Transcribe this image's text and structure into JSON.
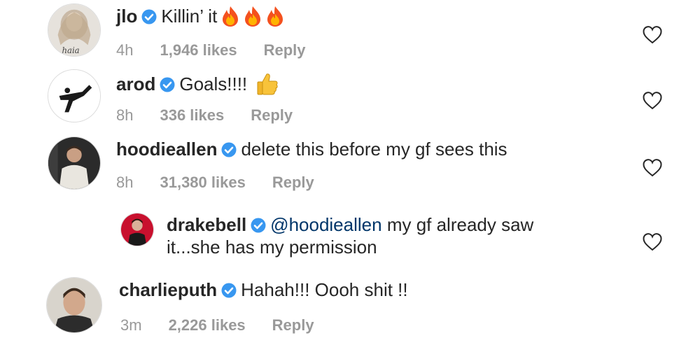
{
  "comments": [
    {
      "username": "jlo",
      "text": "Killin’ it",
      "emoji": [
        "fire-emoji",
        "fire-emoji",
        "fire-emoji"
      ],
      "time": "4h",
      "likes": "1,946 likes",
      "reply": "Reply"
    },
    {
      "username": "arod",
      "text": "Goals!!!!",
      "emoji": [
        "thumbs-up-emoji"
      ],
      "time": "8h",
      "likes": "336 likes",
      "reply": "Reply"
    },
    {
      "username": "hoodieallen",
      "text": "delete this before my gf sees this",
      "time": "8h",
      "likes": "31,380 likes",
      "reply": "Reply"
    },
    {
      "username": "drakebell",
      "mention": "@hoodieallen",
      "text_line1": "my gf already saw",
      "text_line2": "it...she has my permission"
    },
    {
      "username": "charlieputh",
      "text": "Hahah!!! Oooh shit !!",
      "time": "3m",
      "likes": "2,226 likes",
      "reply": "Reply"
    }
  ],
  "colors": {
    "verified_badge": "#3897f0",
    "meta_text": "#999999",
    "mention": "#003569"
  }
}
